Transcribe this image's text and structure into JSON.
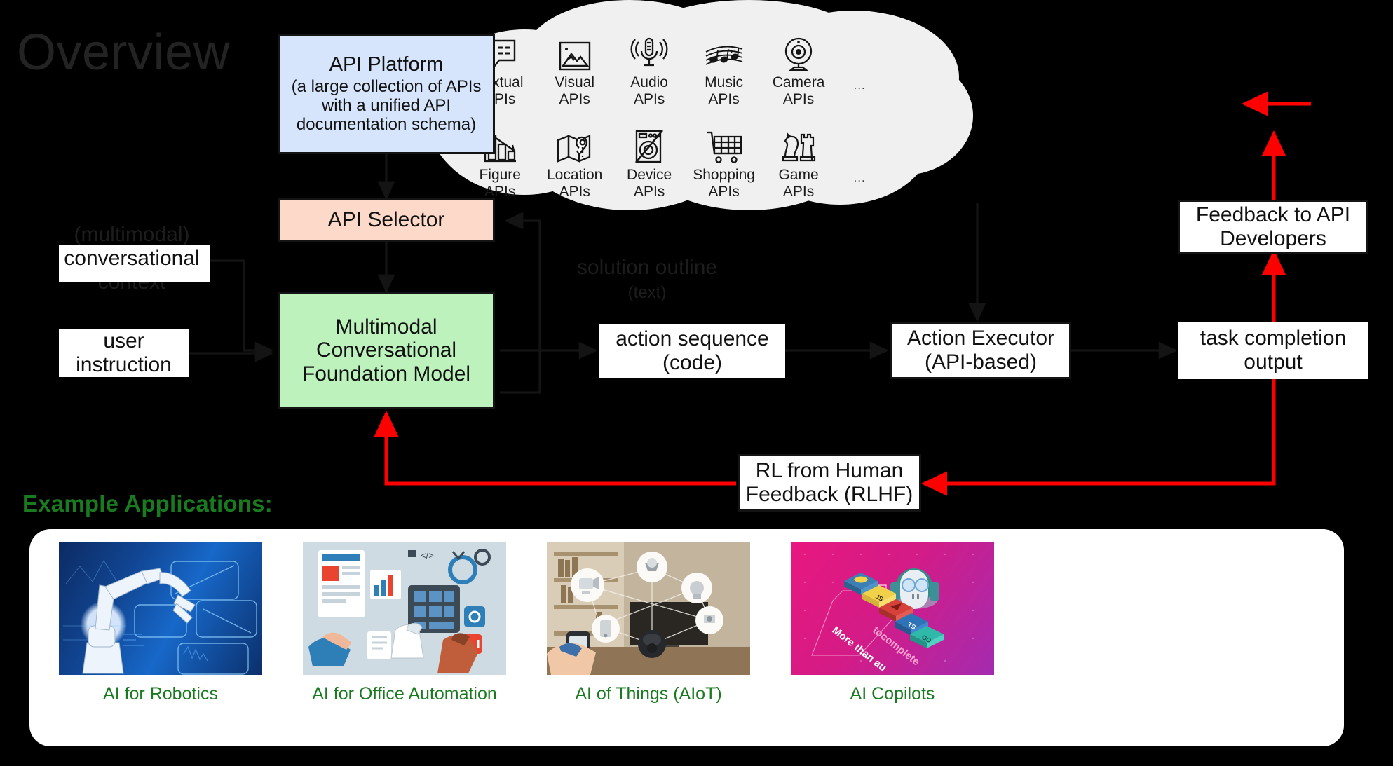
{
  "page": {
    "title": "Overview",
    "background": "#000000",
    "accent_red": "#ff0000",
    "accent_green": "#1a7a20"
  },
  "boxes": {
    "api_platform": {
      "title": "API Platform",
      "subtitle": "(a large collection of APIs with a unified API documentation schema)",
      "color": "#d6e5fb"
    },
    "api_selector": {
      "title": "API Selector",
      "color": "#fcd9c8"
    },
    "foundation_model": {
      "line1": "Multimodal",
      "line2": "Conversational",
      "line3": "Foundation Model",
      "color": "#bdf2bd"
    },
    "conversational_context": {
      "line1": "(multimodal)",
      "line2": "conversational",
      "line3": "context"
    },
    "user_instruction": {
      "line1": "user",
      "line2": "instruction"
    },
    "action_sequence": {
      "line1": "action sequence",
      "line2": "(code)"
    },
    "action_executor": {
      "line1": "Action Executor",
      "line2": "(API-based)"
    },
    "task_completion": {
      "line1": "task completion",
      "line2": "output"
    },
    "feedback_developers": {
      "line1": "Feedback to API",
      "line2": "Developers"
    },
    "rlhf": {
      "line1": "RL from Human",
      "line2": "Feedback (RLHF)"
    },
    "solution_outline": {
      "line1": "solution outline",
      "line2": "(text)"
    }
  },
  "cloud": {
    "row1": [
      {
        "icon": "textual-api-icon",
        "line1": "Textual",
        "line2": "APIs"
      },
      {
        "icon": "visual-api-icon",
        "line1": "Visual",
        "line2": "APIs"
      },
      {
        "icon": "audio-api-icon",
        "line1": "Audio",
        "line2": "APIs"
      },
      {
        "icon": "music-api-icon",
        "line1": "Music",
        "line2": "APIs"
      },
      {
        "icon": "camera-api-icon",
        "line1": "Camera",
        "line2": "APIs"
      }
    ],
    "row2": [
      {
        "icon": "figure-api-icon",
        "line1": "Figure",
        "line2": "APIs"
      },
      {
        "icon": "location-api-icon",
        "line1": "Location",
        "line2": "APIs"
      },
      {
        "icon": "device-api-icon",
        "line1": "Device",
        "line2": "APIs"
      },
      {
        "icon": "shopping-api-icon",
        "line1": "Shopping",
        "line2": "APIs"
      },
      {
        "icon": "game-api-icon",
        "line1": "Game",
        "line2": "APIs"
      }
    ],
    "ellipsis1": "...",
    "ellipsis2": "..."
  },
  "examples": {
    "heading": "Example Applications:",
    "cards": [
      {
        "caption": "AI for Robotics"
      },
      {
        "caption": "AI for Office Automation"
      },
      {
        "caption": "AI of Things (AIoT)"
      },
      {
        "caption": "AI Copilots"
      }
    ]
  }
}
